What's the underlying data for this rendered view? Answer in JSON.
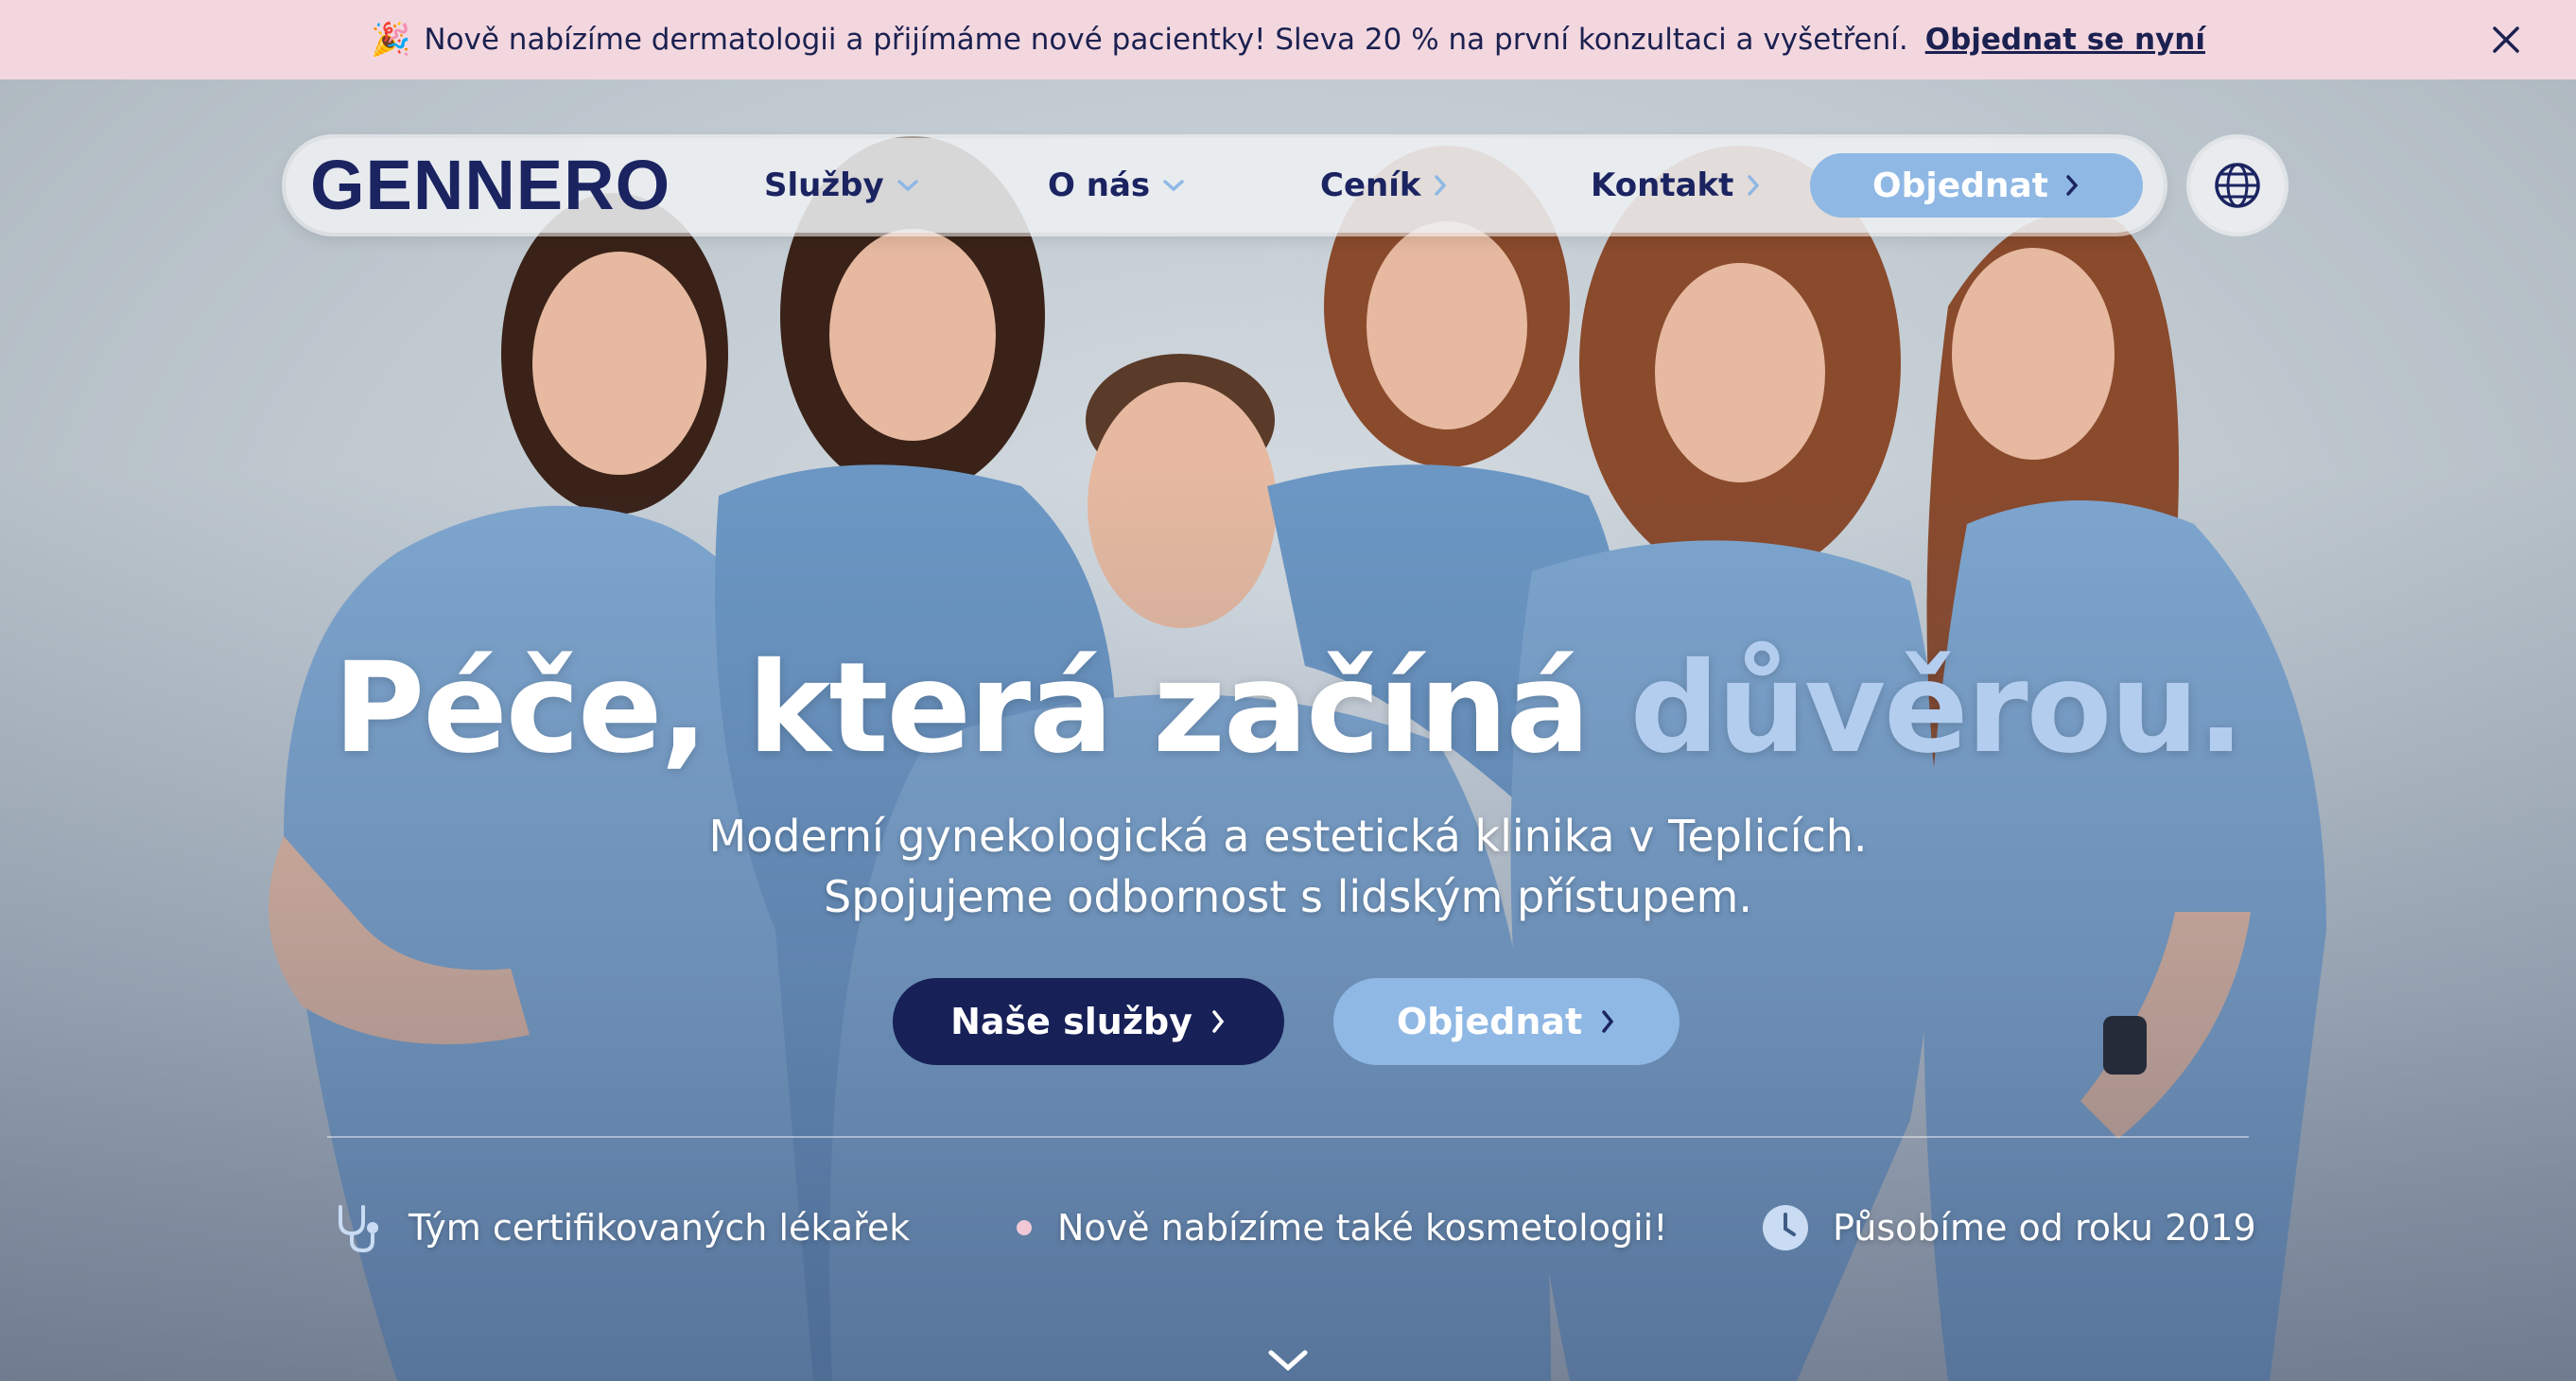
{
  "announcement": {
    "emoji": "🎉",
    "text": "Nově nabízíme dermatologii a přijímáme nové pacientky! Sleva 20 % na první konzultaci a vyšetření.",
    "link": "Objednat se nyní",
    "close_icon": "close-icon"
  },
  "nav": {
    "logo": "GENNERO",
    "items": [
      {
        "label": "Služby",
        "icon": "chevron-down-icon"
      },
      {
        "label": "O nás",
        "icon": "chevron-down-icon"
      },
      {
        "label": "Ceník",
        "icon": "chevron-right-icon"
      },
      {
        "label": "Kontakt",
        "icon": "chevron-right-icon"
      }
    ],
    "cta": "Objednat",
    "language_icon": "globe-icon"
  },
  "hero": {
    "headline_main": "Péče, která začíná ",
    "headline_accent": "důvěrou.",
    "subtitle_line1": "Moderní gynekologická a estetická klinika v Teplicích.",
    "subtitle_line2": "Spojujeme odbornost s lidským přístupem.",
    "button_primary": "Naše služby",
    "button_secondary": "Objednat",
    "accent_color": "#b3cdef"
  },
  "features": [
    {
      "icon": "stethoscope-icon",
      "text": "Tým certifikovaných lékařek"
    },
    {
      "icon": "dot-icon",
      "text": "Nově nabízíme také kosmetologii!"
    },
    {
      "icon": "clock-icon",
      "text": "Působíme od roku 2019"
    }
  ],
  "colors": {
    "navy": "#172057",
    "light_blue": "#8fb8e4",
    "banner_pink": "#f3d7df"
  }
}
